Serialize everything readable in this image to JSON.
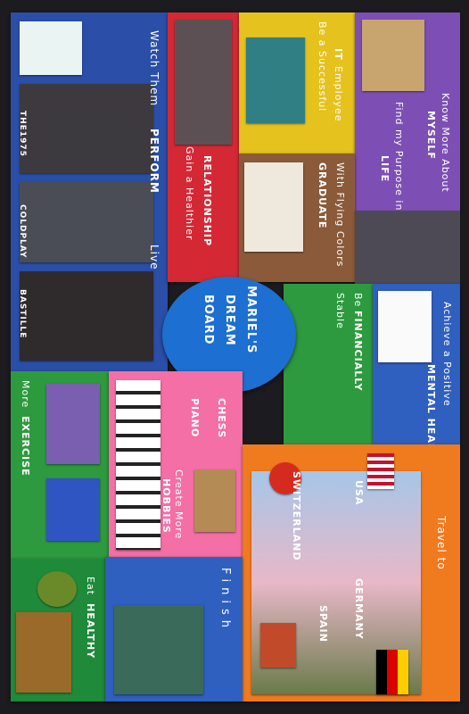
{
  "board_title": "MARIEL'S DREAM BOARD",
  "title_parts": [
    "MARIEL'S",
    "DREAM",
    "BOARD"
  ],
  "band_labels": [
    "THE1975",
    "COLDPLAY",
    "BASTILLE"
  ],
  "sections": {
    "perform": {
      "text": "Watch Them",
      "highlight": "PERFORM",
      "tail": "Live"
    },
    "relationships": {
      "text": "Gain a Healthier",
      "highlight": "RELATIONSHIP"
    },
    "employee": {
      "text": "Be a Successful",
      "highlight": "IT",
      "tail": "Employee"
    },
    "myself": {
      "text": "Know More About",
      "highlight": "MYSELF"
    },
    "purpose": {
      "text": "Find my Purpose in",
      "highlight": "LIFE"
    },
    "graduate": {
      "highlight": "GRADUATE",
      "tail": "With Flying Colors"
    },
    "financially": {
      "text": "Be",
      "highlight": "FINANCIALLY",
      "tail": "Stable"
    },
    "mental": {
      "text": "Achieve a Positive",
      "highlight": "MENTAL HEALTH"
    },
    "exercise": {
      "text": "More",
      "highlight": "EXERCISE"
    },
    "chess": {
      "highlight": "CHESS"
    },
    "piano": {
      "highlight": "PIANO"
    },
    "hobbies": {
      "text": "Create More",
      "highlight": "HOBBIES"
    },
    "travel": {
      "text": "Travel to",
      "places": [
        "USA",
        "SWITZERLAND",
        "GERMANY",
        "SPAIN"
      ]
    },
    "finish": {
      "text": "Finish"
    },
    "eat": {
      "text": "Eat",
      "highlight": "HEALTHY"
    }
  },
  "colors": {
    "blue": "#2b4fa8",
    "red": "#d42935",
    "yellow": "#e6c21f",
    "purple": "#7d4fb5",
    "brown": "#8a5a3a",
    "green": "#2e9a3f",
    "teal_blue": "#2f5fbf",
    "pink": "#f46fa6",
    "orange": "#f07a1e",
    "dark_green": "#1f8a3a",
    "dot_peach": "#f6b98e",
    "dot_purple": "#b48be0",
    "dot_green": "#7cc96b",
    "dot_blue": "#6a8fe0",
    "dot_pink": "#f08aa8",
    "dot_yellow": "#f0e06a"
  },
  "icons": [
    "eve-avatar-icon",
    "graduation-cap-icon",
    "computer-icon",
    "brain-icon",
    "jump-rope-icon",
    "dumbbells-icon",
    "piano-icon",
    "chess-board-icon",
    "avocado-icon",
    "usa-flag-icon",
    "swiss-flag-icon",
    "germany-map-icon",
    "spain-map-icon"
  ]
}
